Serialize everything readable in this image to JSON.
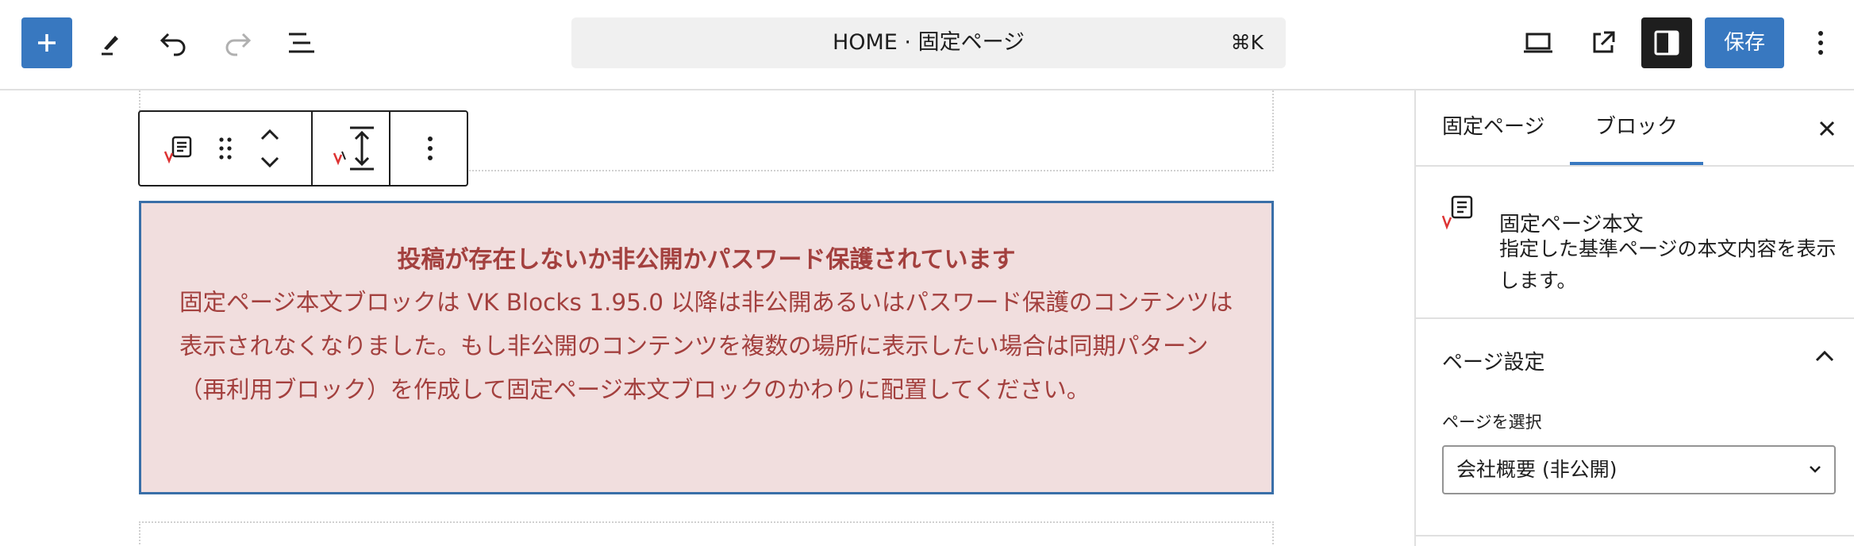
{
  "header": {
    "document_title": "HOME · 固定ページ",
    "shortcut": "⌘K",
    "save_label": "保存"
  },
  "block_toolbar": {
    "icons": [
      "page-content-block-icon",
      "drag-handle-icon",
      "move-up-down-icon",
      "vertical-space-icon",
      "more-options-icon"
    ]
  },
  "notice": {
    "title": "投稿が存在しないか非公開かパスワード保護されています",
    "body": "固定ページ本文ブロックは VK Blocks 1.95.0 以降は非公開あるいはパスワード保護のコンテンツは表示されなくなりました。もし非公開のコンテンツを複数の場所に表示したい場合は同期パターン（再利用ブロック）を作成して固定ページ本文ブロックのかわりに配置してください。"
  },
  "sidebar": {
    "tabs": [
      {
        "label": "固定ページ",
        "active": false
      },
      {
        "label": "ブロック",
        "active": true
      }
    ],
    "block_card": {
      "title": "固定ページ本文",
      "description": "指定した基準ページの本文内容を表示します。"
    },
    "panel": {
      "title": "ページ設定",
      "field_label": "ページを選択",
      "selected_value": "会社概要 (非公開)"
    }
  },
  "colors": {
    "accent": "#3878c0",
    "notice_bg": "#f1dede",
    "notice_text": "#a3403e",
    "dark": "#1e1e1e"
  }
}
